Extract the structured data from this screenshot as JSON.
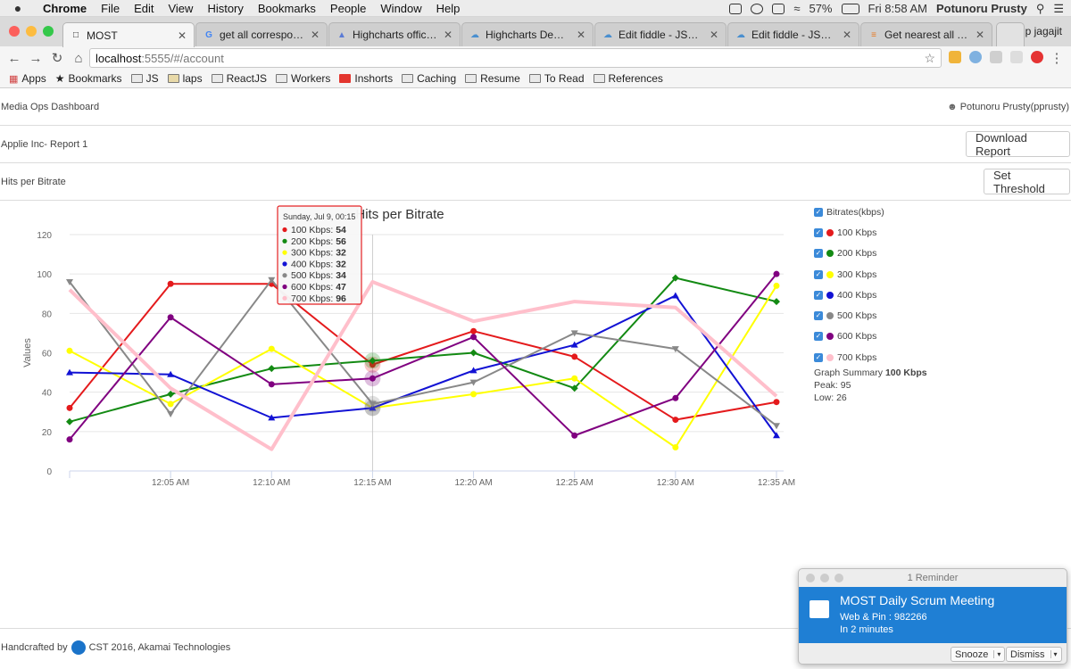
{
  "menubar": {
    "app": "Chrome",
    "items": [
      "File",
      "Edit",
      "View",
      "History",
      "Bookmarks",
      "People",
      "Window",
      "Help"
    ],
    "battery": "57%",
    "clock": "Fri 8:58 AM",
    "user": "Potunoru Prusty"
  },
  "tabs": [
    {
      "label": "MOST",
      "active": true
    },
    {
      "label": "get all corresponding"
    },
    {
      "label": "Highcharts official sup"
    },
    {
      "label": "Highcharts Demo - JS"
    },
    {
      "label": "Edit fiddle - JSFiddle"
    },
    {
      "label": "Edit fiddle - JSFiddle"
    },
    {
      "label": "Get nearest all Y value"
    }
  ],
  "profile_name": "p jagajit",
  "address": {
    "host": "localhost",
    "path": ":5555/#/account"
  },
  "bookmarks": [
    "Apps",
    "Bookmarks",
    "JS",
    "laps",
    "ReactJS",
    "Workers",
    "Inshorts",
    "Caching",
    "Resume",
    "To Read",
    "References"
  ],
  "header": {
    "title": "Media Ops Dashboard",
    "user": "Potunoru Prusty(pprusty)"
  },
  "report": {
    "title": "Applie Inc- Report 1",
    "download_label": "Download Report"
  },
  "section": {
    "title": "Hits per Bitrate",
    "threshold_label": "Set Threshold"
  },
  "chart_data": {
    "type": "line",
    "title": "Hits per Bitrate",
    "ylabel": "Values",
    "ylim": [
      0,
      120
    ],
    "yticks": [
      0,
      20,
      40,
      60,
      80,
      100,
      120
    ],
    "x": [
      "12:00 AM",
      "12:05 AM",
      "12:10 AM",
      "12:15 AM",
      "12:20 AM",
      "12:25 AM",
      "12:30 AM",
      "12:35 AM"
    ],
    "xtick_labels": [
      "12:05 AM",
      "12:10 AM",
      "12:15 AM",
      "12:20 AM",
      "12:25 AM",
      "12:30 AM",
      "12:35 AM"
    ],
    "series": [
      {
        "name": "100 Kbps",
        "color": "#e41a1c",
        "marker": "circle",
        "values": [
          32,
          95,
          95,
          54,
          71,
          58,
          26,
          35
        ]
      },
      {
        "name": "200 Kbps",
        "color": "#138a13",
        "marker": "diamond",
        "values": [
          25,
          39,
          52,
          56,
          60,
          42,
          98,
          86
        ]
      },
      {
        "name": "300 Kbps",
        "color": "#ffff00",
        "marker": "circle",
        "values": [
          61,
          34,
          62,
          32,
          39,
          47,
          12,
          94
        ]
      },
      {
        "name": "400 Kbps",
        "color": "#1212d4",
        "marker": "triangle",
        "values": [
          50,
          49,
          27,
          32,
          51,
          64,
          89,
          18
        ]
      },
      {
        "name": "500 Kbps",
        "color": "#888888",
        "marker": "triangle-down",
        "values": [
          96,
          29,
          97,
          34,
          45,
          70,
          62,
          23
        ]
      },
      {
        "name": "600 Kbps",
        "color": "#800080",
        "marker": "circle",
        "values": [
          16,
          78,
          44,
          47,
          68,
          18,
          37,
          100
        ]
      },
      {
        "name": "700 Kbps",
        "color": "#ffbfcb",
        "marker": "none",
        "values": [
          92,
          42,
          11,
          96,
          76,
          86,
          83,
          38
        ]
      }
    ],
    "hover_index": 3,
    "tooltip": {
      "header": "Sunday, Jul 9, 00:15",
      "rows": [
        {
          "name": "100 Kbps",
          "value": "54"
        },
        {
          "name": "200 Kbps",
          "value": "56"
        },
        {
          "name": "300 Kbps",
          "value": "32"
        },
        {
          "name": "400 Kbps",
          "value": "32"
        },
        {
          "name": "500 Kbps",
          "value": "34"
        },
        {
          "name": "600 Kbps",
          "value": "47"
        },
        {
          "name": "700 Kbps",
          "value": "96"
        }
      ]
    }
  },
  "legend": {
    "title": "Bitrates(kbps)",
    "items": [
      {
        "label": "100 Kbps",
        "color": "#e41a1c"
      },
      {
        "label": "200 Kbps",
        "color": "#138a13"
      },
      {
        "label": "300 Kbps",
        "color": "#ffff00"
      },
      {
        "label": "400 Kbps",
        "color": "#1212d4"
      },
      {
        "label": "500 Kbps",
        "color": "#888888"
      },
      {
        "label": "600 Kbps",
        "color": "#800080"
      },
      {
        "label": "700 Kbps",
        "color": "#ffbfcb"
      }
    ]
  },
  "summary": {
    "prefix": "Graph Summary",
    "series": "100 Kbps",
    "peak": "Peak: 95",
    "low": "Low: 26"
  },
  "footer": {
    "prefix": "Handcrafted by",
    "suffix": "CST 2016, Akamai Technologies"
  },
  "notification": {
    "header": "1 Reminder",
    "title": "MOST Daily Scrum Meeting",
    "line1": "Web & Pin : 982266",
    "line2": "In 2 minutes",
    "snooze": "Snooze",
    "dismiss": "Dismiss"
  }
}
